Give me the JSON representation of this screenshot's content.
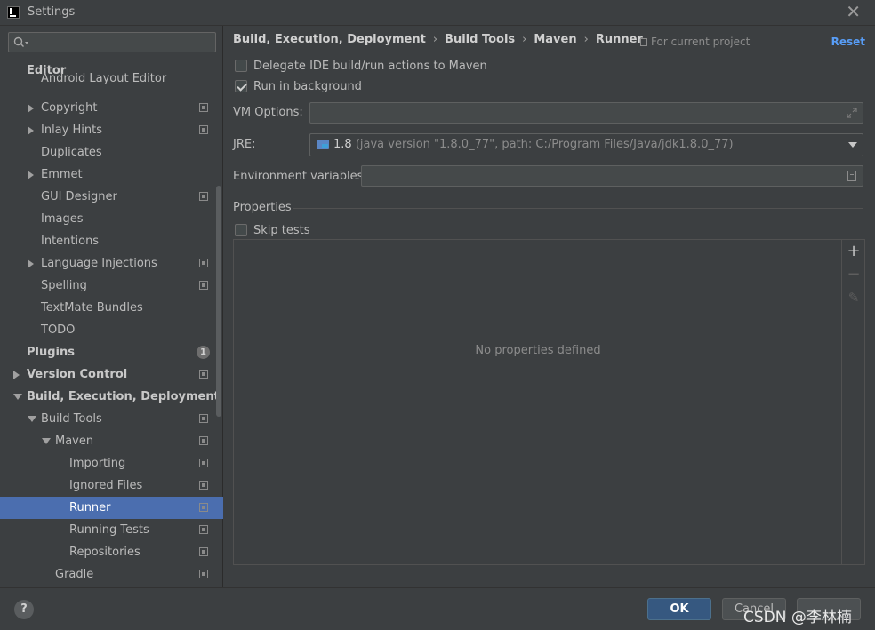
{
  "window": {
    "title": "Settings",
    "close_glyph": "✕"
  },
  "search": {
    "placeholder": ""
  },
  "tree": [
    {
      "label": "Editor",
      "bold": true,
      "level": 0,
      "arrow": "none",
      "project_icon": false
    },
    {
      "label": "Android Layout Editor",
      "bold": false,
      "level": 1,
      "arrow": "none",
      "project_icon": false,
      "partial": true
    },
    {
      "label": "Copyright",
      "bold": false,
      "level": 1,
      "arrow": "right",
      "project_icon": true
    },
    {
      "label": "Inlay Hints",
      "bold": false,
      "level": 1,
      "arrow": "right",
      "project_icon": true
    },
    {
      "label": "Duplicates",
      "bold": false,
      "level": 1,
      "arrow": "none",
      "project_icon": false
    },
    {
      "label": "Emmet",
      "bold": false,
      "level": 1,
      "arrow": "right",
      "project_icon": false
    },
    {
      "label": "GUI Designer",
      "bold": false,
      "level": 1,
      "arrow": "none",
      "project_icon": true
    },
    {
      "label": "Images",
      "bold": false,
      "level": 1,
      "arrow": "none",
      "project_icon": false
    },
    {
      "label": "Intentions",
      "bold": false,
      "level": 1,
      "arrow": "none",
      "project_icon": false
    },
    {
      "label": "Language Injections",
      "bold": false,
      "level": 1,
      "arrow": "right",
      "project_icon": true
    },
    {
      "label": "Spelling",
      "bold": false,
      "level": 1,
      "arrow": "none",
      "project_icon": true
    },
    {
      "label": "TextMate Bundles",
      "bold": false,
      "level": 1,
      "arrow": "none",
      "project_icon": false
    },
    {
      "label": "TODO",
      "bold": false,
      "level": 1,
      "arrow": "none",
      "project_icon": false
    },
    {
      "label": "Plugins",
      "bold": true,
      "level": 0,
      "arrow": "none",
      "project_icon": false,
      "badge": "1"
    },
    {
      "label": "Version Control",
      "bold": true,
      "level": 0,
      "arrow": "right",
      "project_icon": true
    },
    {
      "label": "Build, Execution, Deployment",
      "bold": true,
      "level": 0,
      "arrow": "down",
      "project_icon": false
    },
    {
      "label": "Build Tools",
      "bold": false,
      "level": 1,
      "arrow": "down",
      "project_icon": true
    },
    {
      "label": "Maven",
      "bold": false,
      "level": 2,
      "arrow": "down",
      "project_icon": true
    },
    {
      "label": "Importing",
      "bold": false,
      "level": 3,
      "arrow": "none",
      "project_icon": true
    },
    {
      "label": "Ignored Files",
      "bold": false,
      "level": 3,
      "arrow": "none",
      "project_icon": true
    },
    {
      "label": "Runner",
      "bold": false,
      "level": 3,
      "arrow": "none",
      "project_icon": true,
      "selected": true
    },
    {
      "label": "Running Tests",
      "bold": false,
      "level": 3,
      "arrow": "none",
      "project_icon": true
    },
    {
      "label": "Repositories",
      "bold": false,
      "level": 3,
      "arrow": "none",
      "project_icon": true
    },
    {
      "label": "Gradle",
      "bold": false,
      "level": 2,
      "arrow": "none",
      "project_icon": true
    }
  ],
  "breadcrumb": [
    "Build, Execution, Deployment",
    "Build Tools",
    "Maven",
    "Runner"
  ],
  "breadcrumb_sep": "›",
  "scope_label": "For current project",
  "reset_label": "Reset",
  "options": {
    "delegate": {
      "label": "Delegate IDE build/run actions to Maven",
      "checked": false
    },
    "background": {
      "label": "Run in background",
      "checked": true
    }
  },
  "vm_options": {
    "label": "VM Options:",
    "value": ""
  },
  "jre": {
    "label": "JRE:",
    "version": "1.8",
    "detail": "(java version \"1.8.0_77\", path: C:/Program Files/Java/jdk1.8.0_77)"
  },
  "env_vars": {
    "label": "Environment variables:",
    "value": ""
  },
  "properties": {
    "title": "Properties",
    "skip_tests": {
      "label": "Skip tests",
      "checked": false
    },
    "empty_text": "No properties defined",
    "toolbar": {
      "add": "+",
      "remove": "−",
      "edit": "✎"
    }
  },
  "footer": {
    "help": "?",
    "ok": "OK",
    "cancel": "Cancel",
    "apply": "",
    "watermark": "CSDN @李林楠"
  }
}
